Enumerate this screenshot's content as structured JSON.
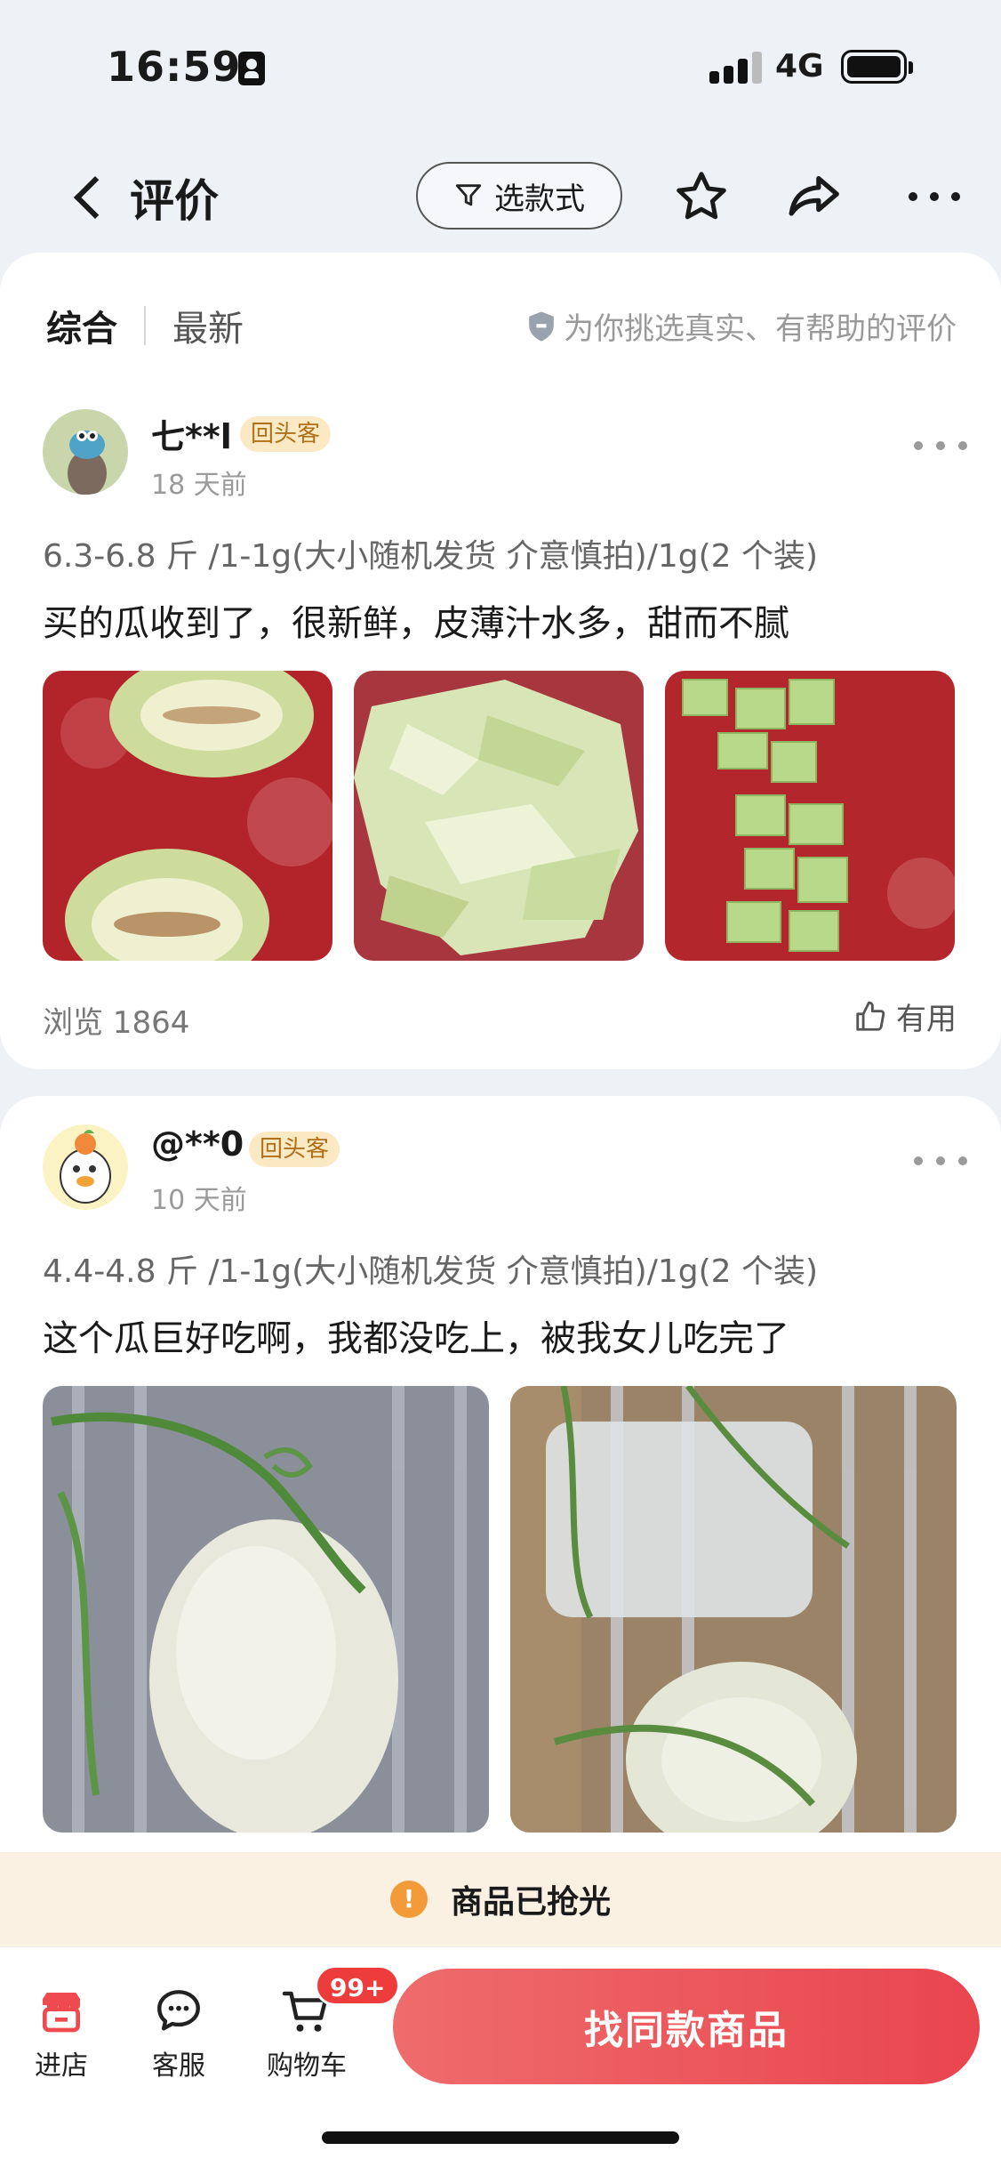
{
  "status_bar": {
    "time": "16:59",
    "network": "4G"
  },
  "nav": {
    "title": "评价",
    "style_filter": "选款式"
  },
  "tabs": {
    "comprehensive": "综合",
    "latest": "最新"
  },
  "tip": "为你挑选真实、有帮助的评价",
  "reviews": [
    {
      "user": "七**l",
      "badge": "回头客",
      "time": "18 天前",
      "spec": "6.3-6.8 斤 /1-1g(大小随机发货 介意慎拍)/1g(2 个装)",
      "text": "买的瓜收到了，很新鲜，皮薄汁水多，甜而不腻",
      "views": "浏览 1864",
      "helpful": "有用"
    },
    {
      "user": "@**0",
      "badge": "回头客",
      "time": "10 天前",
      "spec": "4.4-4.8 斤 /1-1g(大小随机发货 介意慎拍)/1g(2 个装)",
      "text": "这个瓜巨好吃啊，我都没吃上，被我女儿吃完了"
    }
  ],
  "sold_out": "商品已抢光",
  "bottom_bar": {
    "shop": "进店",
    "service": "客服",
    "cart": "购物车",
    "cart_badge": "99+",
    "cta": "找同款商品"
  }
}
